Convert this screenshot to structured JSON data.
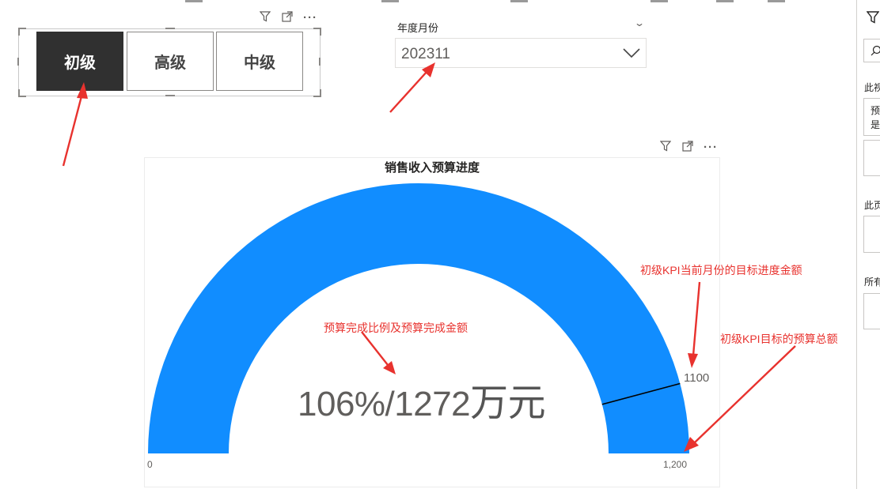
{
  "visual_icons": [
    "filter-icon",
    "focus-mode-icon",
    "more-options-icon"
  ],
  "slicer": {
    "items": [
      {
        "label": "初级",
        "selected": true
      },
      {
        "label": "高级",
        "selected": false
      },
      {
        "label": "中级",
        "selected": false
      }
    ]
  },
  "date_slicer": {
    "label": "年度月份",
    "value": "202311"
  },
  "gauge": {
    "title": "销售收入预算进度",
    "value_text": "106%/1272",
    "unit": "万元",
    "min_label": "0",
    "max_label": "1,200",
    "target_label": "1100",
    "fill_color": "#118dff"
  },
  "chart_data": {
    "type": "gauge",
    "title": "销售收入预算进度",
    "min": 0,
    "max": 1200,
    "value": 1272,
    "target": 1100,
    "percent_text": "106%",
    "unit": "万元"
  },
  "annotations": {
    "target_note": "初级KPI当前月份的目标进度金额",
    "value_note": "预算完成比例及预算完成金额",
    "max_note": "初级KPI目标的预算总额"
  },
  "filter_pane": {
    "lines": [
      "此视",
      "预",
      "是",
      "此页",
      "所有"
    ]
  },
  "colors": {
    "accent": "#118dff",
    "annotation": "#e8322e",
    "selected_slicer": "#303030"
  }
}
